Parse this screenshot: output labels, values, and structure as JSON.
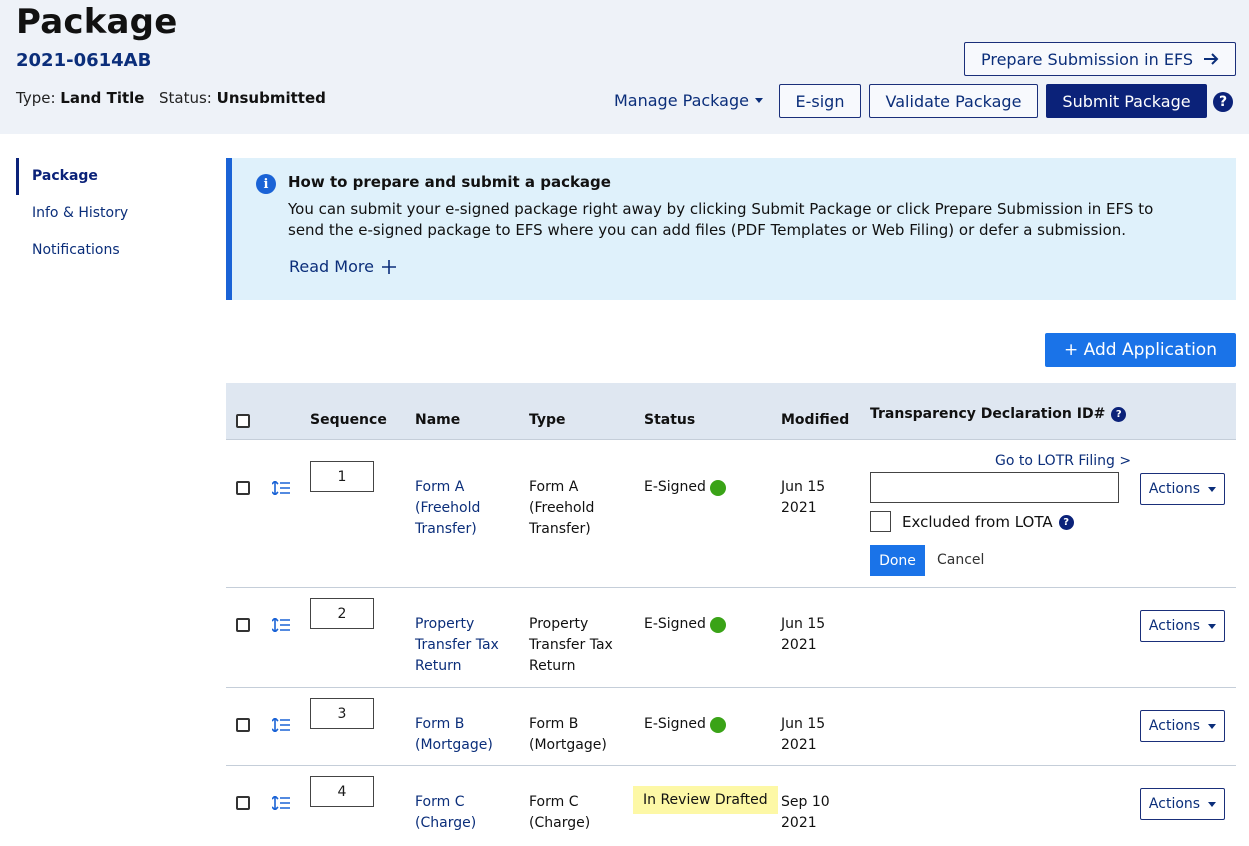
{
  "header": {
    "title": "Package",
    "package_id": "2021-0614AB",
    "type_label": "Type:",
    "type_value": "Land Title",
    "status_label": "Status:",
    "status_value": "Unsubmitted",
    "prepare_button": "Prepare Submission in EFS",
    "manage_package": "Manage Package",
    "esign_button": "E-sign",
    "validate_button": "Validate Package",
    "submit_button": "Submit Package",
    "help_glyph": "?"
  },
  "sidebar": {
    "items": [
      {
        "label": "Package",
        "active": true
      },
      {
        "label": "Info & History",
        "active": false
      },
      {
        "label": "Notifications",
        "active": false
      }
    ]
  },
  "info": {
    "icon_glyph": "i",
    "title": "How to prepare and submit a package",
    "body": "You can submit your e-signed package right away by clicking Submit Package or click Prepare Submission in EFS to send the e-signed package to EFS where you can add files (PDF Templates or Web Filing) or defer a submission.",
    "read_more": "Read More"
  },
  "add_application_button": "+ Add Application",
  "table": {
    "headers": {
      "sequence": "Sequence",
      "name": "Name",
      "type": "Type",
      "status": "Status",
      "modified": "Modified",
      "transparency": "Transparency Declaration ID#"
    },
    "rows": [
      {
        "sequence": "1",
        "name_line1": "Form A",
        "name_line2": "(Freehold",
        "name_line3": "Transfer)",
        "type_line1": "Form A",
        "type_line2": "(Freehold",
        "type_line3": "Transfer)",
        "status": "E-Signed",
        "modified_line1": "Jun 15",
        "modified_line2": "2021",
        "actions": "Actions"
      },
      {
        "sequence": "2",
        "name_line1": "Property",
        "name_line2": "Transfer Tax",
        "name_line3": "Return",
        "type_line1": "Property",
        "type_line2": "Transfer Tax",
        "type_line3": "Return",
        "status": "E-Signed",
        "modified_line1": "Jun 15",
        "modified_line2": "2021",
        "actions": "Actions"
      },
      {
        "sequence": "3",
        "name_line1": "Form B",
        "name_line2": "(Mortgage)",
        "name_line3": "",
        "type_line1": "Form B",
        "type_line2": "(Mortgage)",
        "type_line3": "",
        "status": "E-Signed",
        "modified_line1": "Jun 15",
        "modified_line2": "2021",
        "actions": "Actions"
      },
      {
        "sequence": "4",
        "name_line1": "Form C",
        "name_line2": "(Charge)",
        "name_line3": "",
        "type_line1": "Form C",
        "type_line2": "(Charge)",
        "type_line3": "",
        "status": "In Review Drafted",
        "modified_line1": "Sep 10",
        "modified_line2": "2021",
        "actions": "Actions"
      }
    ],
    "lotr_link": "Go to LOTR Filing >",
    "transparency_input_value": "",
    "excluded_label": "Excluded from LOTA",
    "done_button": "Done",
    "cancel_button": "Cancel"
  },
  "colors": {
    "navy": "#0b2279",
    "link": "#0b2e7a",
    "primary_blue": "#1a73e8",
    "info_bg": "#dff1fb",
    "header_bg": "#eef2f8",
    "signed_green": "#3aa317",
    "review_yellow": "#fdf8a6"
  }
}
